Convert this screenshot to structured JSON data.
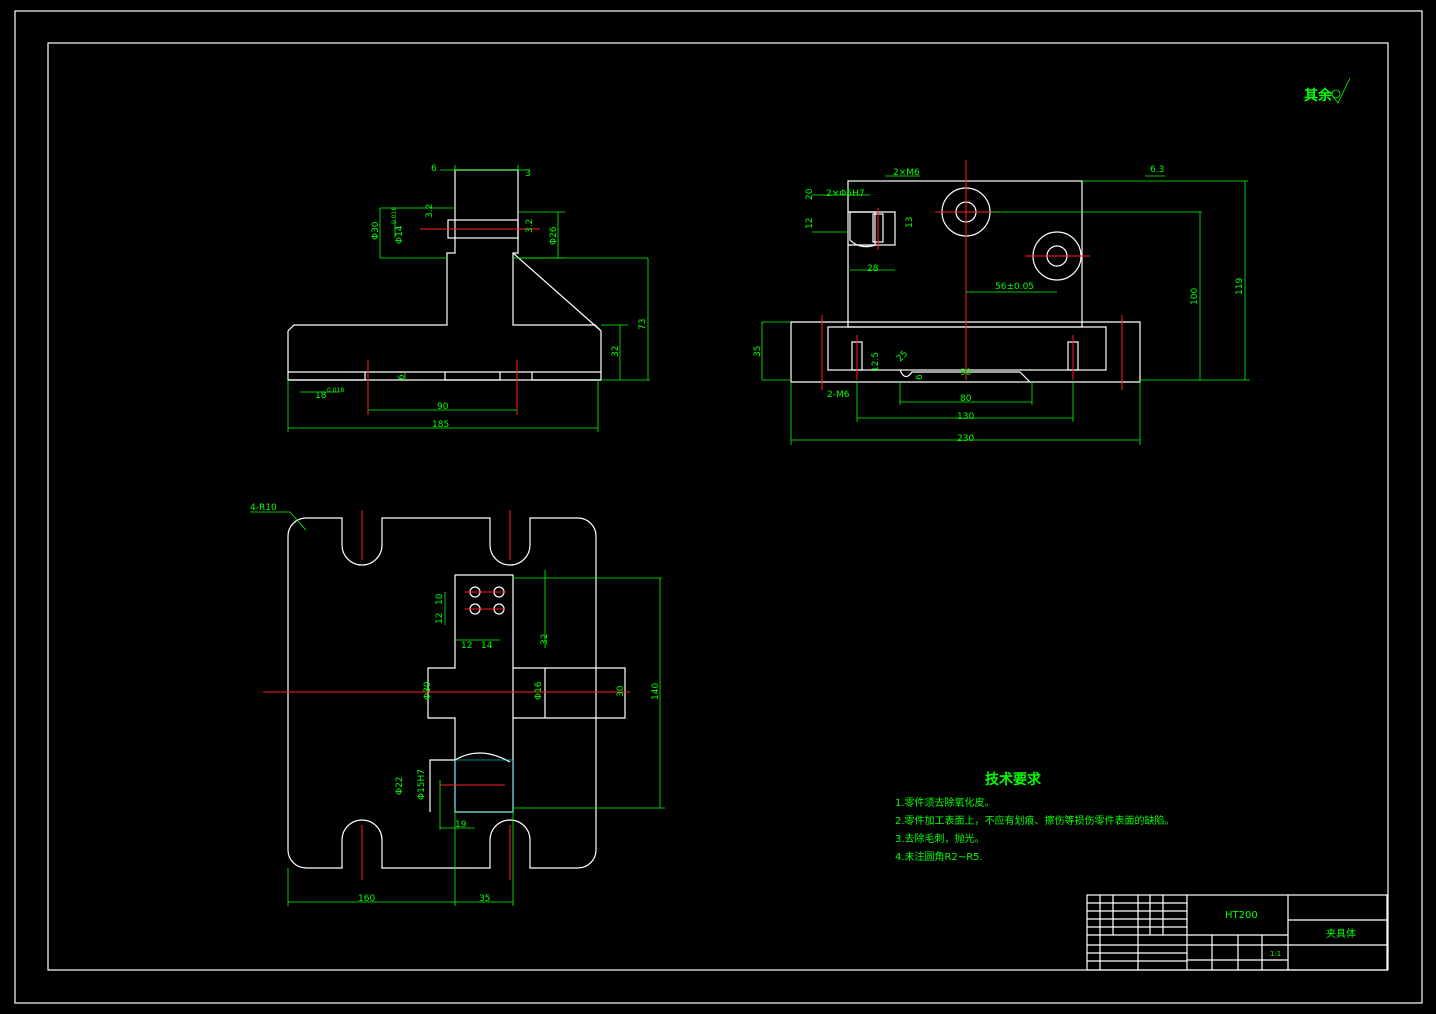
{
  "surface_note": "其余",
  "technical_requirements": {
    "title": "技术要求",
    "items": [
      "1.零件须去除氧化皮。",
      "2.零件加工表面上，不应有划痕、擦伤等损伤零件表面的缺陷。",
      "3.去除毛刺，抛光。",
      "4.未注圆角R2~R5."
    ]
  },
  "title_block": {
    "material": "HT200",
    "part_name": "夹具体",
    "scale": "1:1"
  },
  "view_front": {
    "dims": [
      "6",
      "3",
      "Φ30",
      "Φ14",
      "0.016",
      "3.2",
      "3.2",
      "Φ26",
      "73",
      "32",
      "6",
      "18",
      "0.018",
      "90",
      "185"
    ]
  },
  "view_side": {
    "dims": [
      "2×M6",
      "2×Φ5H7",
      "20",
      "12",
      "13",
      "28",
      "56±0.05",
      "100",
      "119",
      "35",
      "25",
      "12.5",
      "2-M6",
      "6",
      "80",
      "90",
      "130",
      "230",
      "6.3"
    ]
  },
  "view_top": {
    "dims": [
      "4-R10",
      "10",
      "12",
      "12",
      "14",
      "32",
      "Φ30",
      "Φ16",
      "30",
      "140",
      "Φ22",
      "Φ15H7",
      "19",
      "160",
      "35"
    ]
  }
}
